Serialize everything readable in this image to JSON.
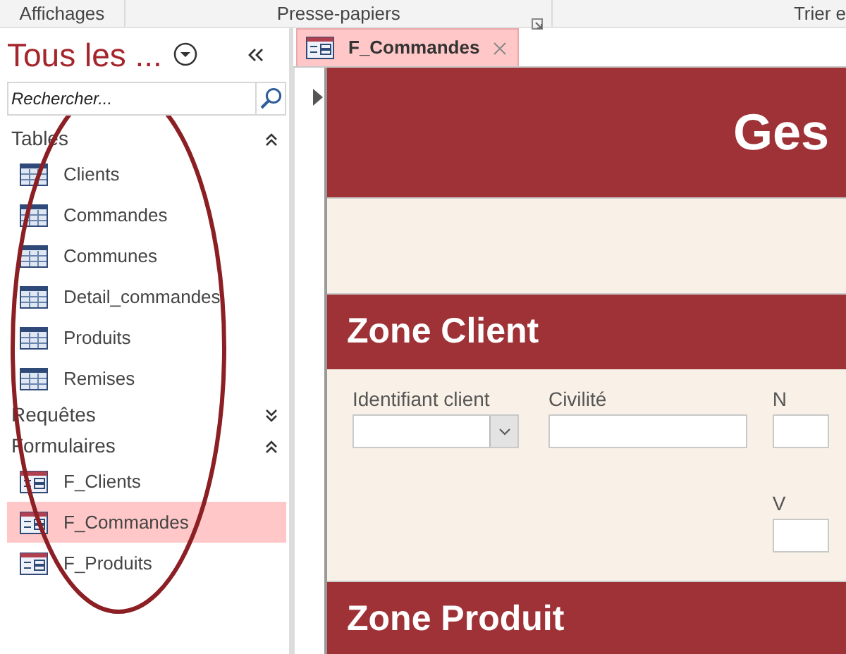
{
  "ribbon": {
    "groups": [
      {
        "label": "Affichages"
      },
      {
        "label": "Presse-papiers",
        "launcher": true
      },
      {
        "label": "Trier e"
      }
    ]
  },
  "navigation": {
    "title": "Tous les ...",
    "search": {
      "placeholder": "Rechercher..."
    },
    "groups": [
      {
        "label": "Tables",
        "kind": "table",
        "expanded": true,
        "items": [
          {
            "label": "Clients",
            "selected": false
          },
          {
            "label": "Commandes",
            "selected": false
          },
          {
            "label": "Communes",
            "selected": false
          },
          {
            "label": "Detail_commandes",
            "selected": false
          },
          {
            "label": "Produits",
            "selected": false
          },
          {
            "label": "Remises",
            "selected": false
          }
        ]
      },
      {
        "label": "Requêtes",
        "expanded": false
      },
      {
        "label": "Formulaires",
        "kind": "form",
        "expanded": true,
        "items": [
          {
            "label": "F_Clients",
            "selected": false
          },
          {
            "label": "F_Commandes",
            "selected": true
          },
          {
            "label": "F_Produits",
            "selected": false
          }
        ]
      }
    ]
  },
  "tabs": [
    {
      "label": "F_Commandes",
      "selected": true
    }
  ],
  "form": {
    "title": "Ges",
    "sections": [
      {
        "title": "Zone Client",
        "columns": [
          [
            {
              "label": "Identifiant client",
              "kind": "combo"
            }
          ],
          [
            {
              "label": "Civilité",
              "kind": "text"
            }
          ],
          [
            {
              "label": "N",
              "kind": "text"
            },
            {
              "label": "V",
              "kind": "text"
            }
          ]
        ]
      },
      {
        "title": "Zone Produit"
      }
    ]
  }
}
